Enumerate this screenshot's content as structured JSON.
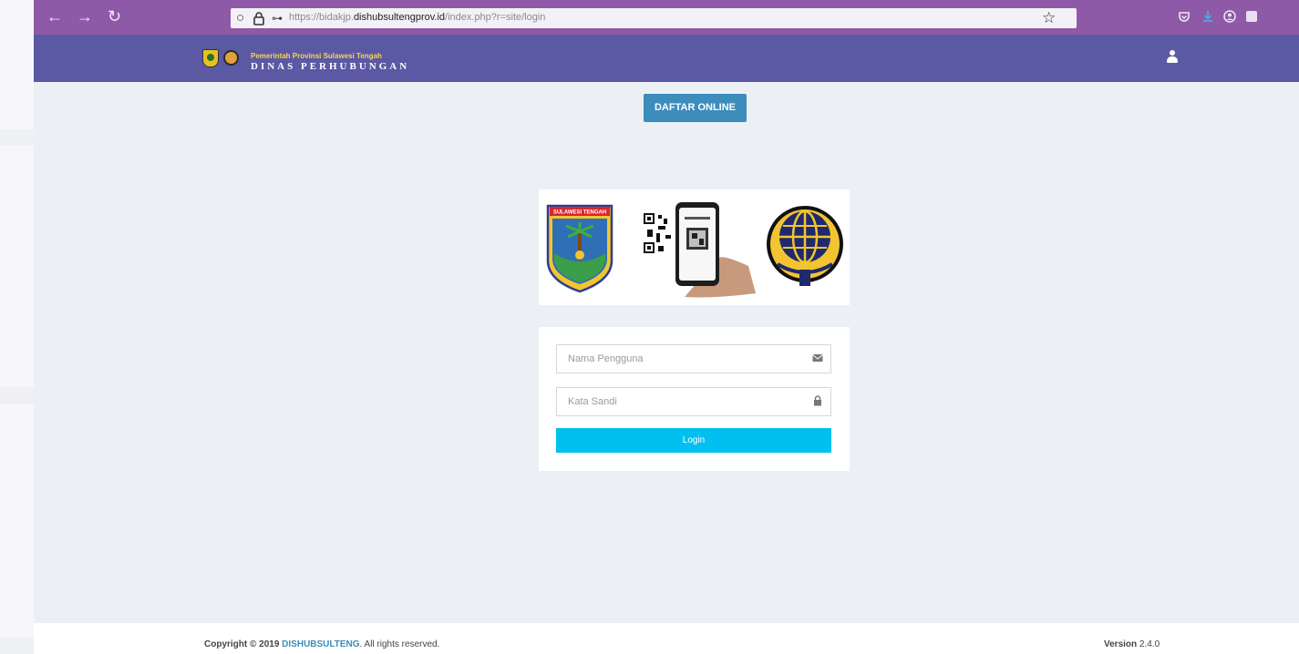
{
  "browser": {
    "url_prefix": "https://bidakjp.",
    "url_domain": "dishubsultengprov.id",
    "url_path": "/index.php?r=site/login"
  },
  "header": {
    "title_top": "Pemerintah Provinsi Sulawesi Tengah",
    "title_bottom": "DINAS PERHUBUNGAN"
  },
  "main": {
    "register_button": "DAFTAR ONLINE",
    "logo_card": {
      "emblem_text": "SULAWESI TENGAH"
    },
    "login_form": {
      "username_placeholder": "Nama Pengguna",
      "password_placeholder": "Kata Sandi",
      "login_button": "Login"
    }
  },
  "footer": {
    "copyright_prefix": "Copyright © 2019 ",
    "brand": "DISHUBSULTENG",
    "copyright_suffix": ". All rights reserved.",
    "version_label": "Version",
    "version_number": "2.4.0"
  },
  "colors": {
    "browser_bar": "#8e5aa8",
    "header": "#5b58a4",
    "primary_button": "#3c8dbc",
    "login_button": "#00c0ef",
    "content_bg": "#ecf0f5"
  }
}
